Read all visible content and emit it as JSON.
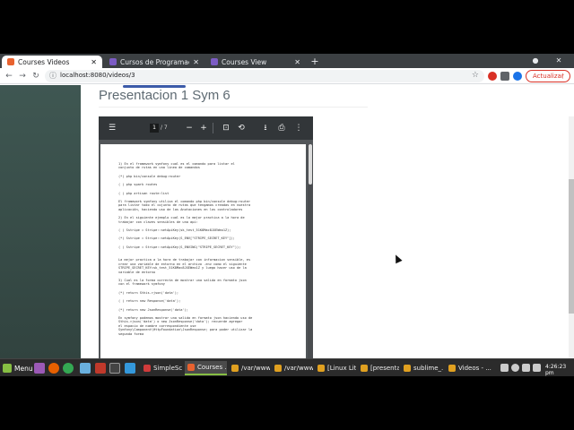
{
  "browser": {
    "tabs": [
      {
        "label": "Courses Videos",
        "active": true,
        "color": "#e8622f"
      },
      {
        "label": "Cursos de Programación",
        "active": false,
        "color": "#7c5cc4"
      },
      {
        "label": "Courses View",
        "active": false,
        "color": "#7c5cc4"
      }
    ],
    "new_tab": "+",
    "url": "localhost:8080/videos/3",
    "update_label": "Actualizar",
    "update_menu": "⋮"
  },
  "page": {
    "title": "Presentacion 1 Sym 6",
    "scroll_top_icon": "arrow-up-icon"
  },
  "pdf": {
    "page_current": "1",
    "page_total": "/ 7",
    "lines": [
      "1) En el framework symfony cual es  el comando para listar el",
      "conjunto de rutas en una linea de comandos",
      "",
      "(*) php bin/console debug:router",
      "",
      "( ) php spark routes",
      "",
      "( ) php artisan route:list",
      "",
      "El framework symfony utiliza el comando php bin/console debug:router",
      "para listar todo el cojunto de rutas que tengamos creadas en nuestra",
      "aplicación, haciendo uso de las Anotaciones en los controladores",
      "",
      "2) En el siguiente ejemplo cual es la mejor practica a la hora de",
      "trabajar con claves sensibles de una api:",
      "",
      "( )  Sstripe = Stripe::setApiKey(sk_test_51K8Mac8JXEWeo1Z);",
      "",
      "(*)  Sstripe = Stripe::setApiKey(S_ENV[\"STRIPE_SECRET_KEY\"]);",
      "",
      "( )  Sstripe = Stripe::setApiKey(S_ENVING(\"STRIPE_SECRET_KEY\"));",
      "",
      "",
      "La mejor practica a la hora de trabajar con informacion sensible, es",
      "crear una variable de entorno en el archivo .env como el siguiente",
      "STRIPE_SECRET_KEY=sk_test_51K8Mac8JXEWeo1Z y luego hacer uso de la",
      "variable de entorno",
      "",
      "3) Cual es la forma correcta de mostrar una salida en formato json",
      "con el framework symfony",
      "",
      "(*) return Sthis->json('data');",
      "",
      "( ) return new Response('data');",
      "",
      "(*) return new JsonResponse('data');",
      "",
      "En symfony podemos mostrar una salida en formato json haciendo uso de",
      "Sthis->json('data') o new JsonResponse('data'); recuerde agregar",
      "el espacio de nombre correspondiente use",
      "Symfony\\Component\\HttpFoundation\\JsonResponse; para poder utilizar la",
      "segunda forma"
    ]
  },
  "taskbar": {
    "menu_label": "Menu",
    "tasks": [
      {
        "label": "SimpleSc...",
        "active": false,
        "color": "#d03b3b"
      },
      {
        "label": "Courses ...",
        "active": true,
        "color": "#e8622f"
      },
      {
        "label": "/var/www...",
        "active": false,
        "color": "#e0a020"
      },
      {
        "label": "/var/www...",
        "active": false,
        "color": "#e0a020"
      },
      {
        "label": "[Linux Lit...",
        "active": false,
        "color": "#e0a020"
      },
      {
        "label": "[presenta...",
        "active": false,
        "color": "#e0a020"
      },
      {
        "label": "sublime_...",
        "active": false,
        "color": "#e0a020"
      },
      {
        "label": "Videos - ...",
        "active": false,
        "color": "#e0a020"
      }
    ],
    "clock": "4:26:23 pm"
  }
}
